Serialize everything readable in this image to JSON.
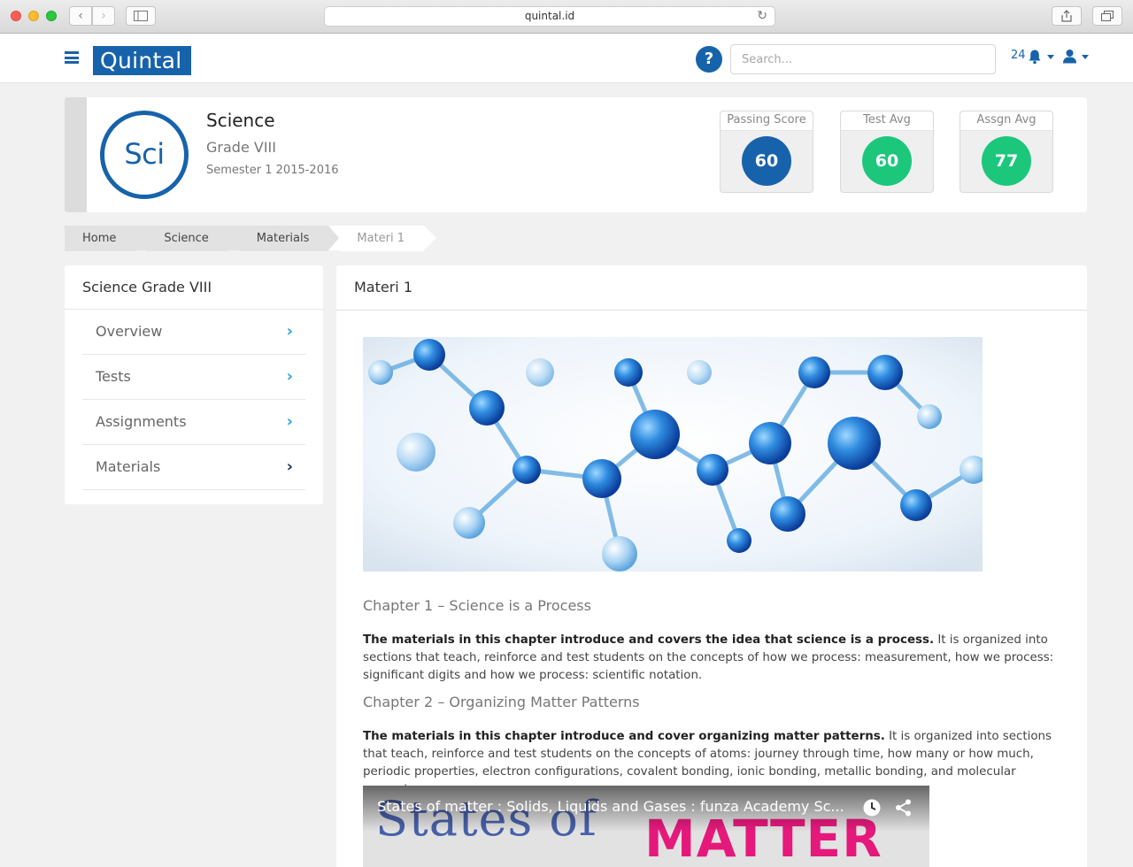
{
  "browser": {
    "url": "quintal.id"
  },
  "header": {
    "logo_text": "Quintal",
    "help_label": "?",
    "search_placeholder": "Search...",
    "notification_count": "24"
  },
  "course": {
    "badge": "Sci",
    "title": "Science",
    "grade": "Grade VIII",
    "semester": "Semester 1 2015-2016",
    "stats": [
      {
        "label": "Passing Score",
        "value": "60",
        "color": "#1763ab"
      },
      {
        "label": "Test Avg",
        "value": "60",
        "color": "#1cc77c"
      },
      {
        "label": "Assgn Avg",
        "value": "77",
        "color": "#1cc77c"
      }
    ]
  },
  "breadcrumb": [
    "Home",
    "Science",
    "Materials",
    "Materi 1"
  ],
  "sidebar": {
    "title": "Science Grade VIII",
    "items": [
      {
        "label": "Overview"
      },
      {
        "label": "Tests"
      },
      {
        "label": "Assignments"
      },
      {
        "label": "Materials"
      }
    ]
  },
  "content": {
    "title": "Materi 1",
    "chapters": [
      {
        "heading": "Chapter 1 – Science is a Process",
        "lead": "The materials in this chapter introduce and covers the idea that science is a process.",
        "body": " It is organized into sections that teach, reinforce and test students on the concepts of how we process: measurement, how we process: significant digits and how we process: scientific notation."
      },
      {
        "heading": "Chapter 2 – Organizing Matter Patterns",
        "lead": "The materials in this chapter introduce and cover organizing matter patterns.",
        "body": " It is organized into sections that teach, reinforce and test students on the concepts of atoms: journey through time, how many or how much, periodic properties, electron configurations, covalent bonding, ionic bonding, metallic bonding, and molecular geometry."
      }
    ],
    "video": {
      "title": "States of matter : Solids, Liquids and Gases : funza Academy Sc...",
      "thumb_text_1": "States of",
      "thumb_text_2": "MATTER"
    }
  },
  "colors": {
    "brand": "#1763ab",
    "accent_green": "#1cc77c",
    "chevron": "#2ea7dc"
  }
}
